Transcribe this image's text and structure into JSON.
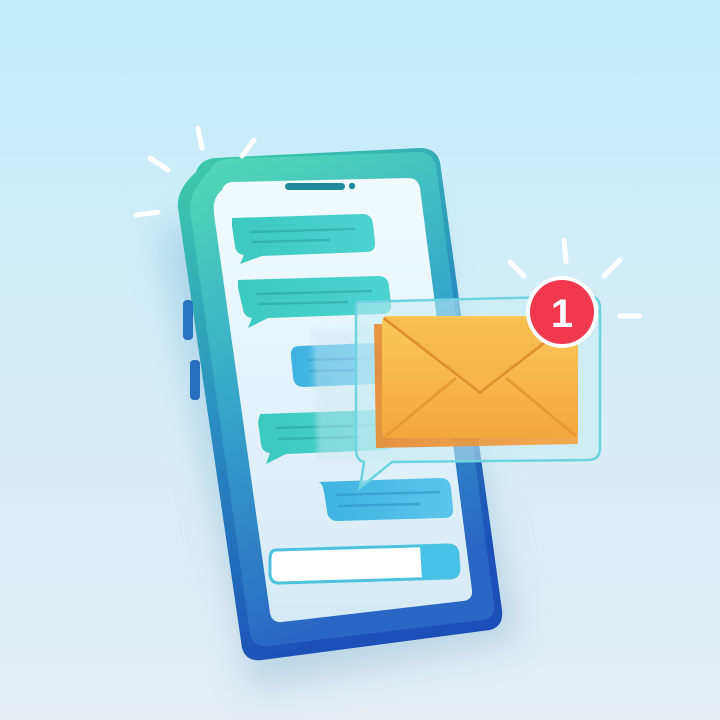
{
  "illustration": {
    "notification_badge": {
      "count": "1",
      "color": "#f2384f",
      "text_color": "#ffffff"
    },
    "colors": {
      "background_top": "#c3ecfb",
      "background_bottom": "#e6eef4",
      "phone_frame_top": "#3fcfaa",
      "phone_frame_bottom": "#1c4fb7",
      "screen": "#e8f6fb",
      "chat_bubble": "#3ec6c9",
      "envelope": "#f7b546",
      "envelope_flap": "#f5a23a",
      "notification_card": "#bfe9f5",
      "sparkle": "#ffffff"
    },
    "icons": [
      "smartphone-icon",
      "chat-bubble-icon",
      "envelope-icon",
      "notification-badge-icon",
      "sparkle-icon"
    ]
  }
}
